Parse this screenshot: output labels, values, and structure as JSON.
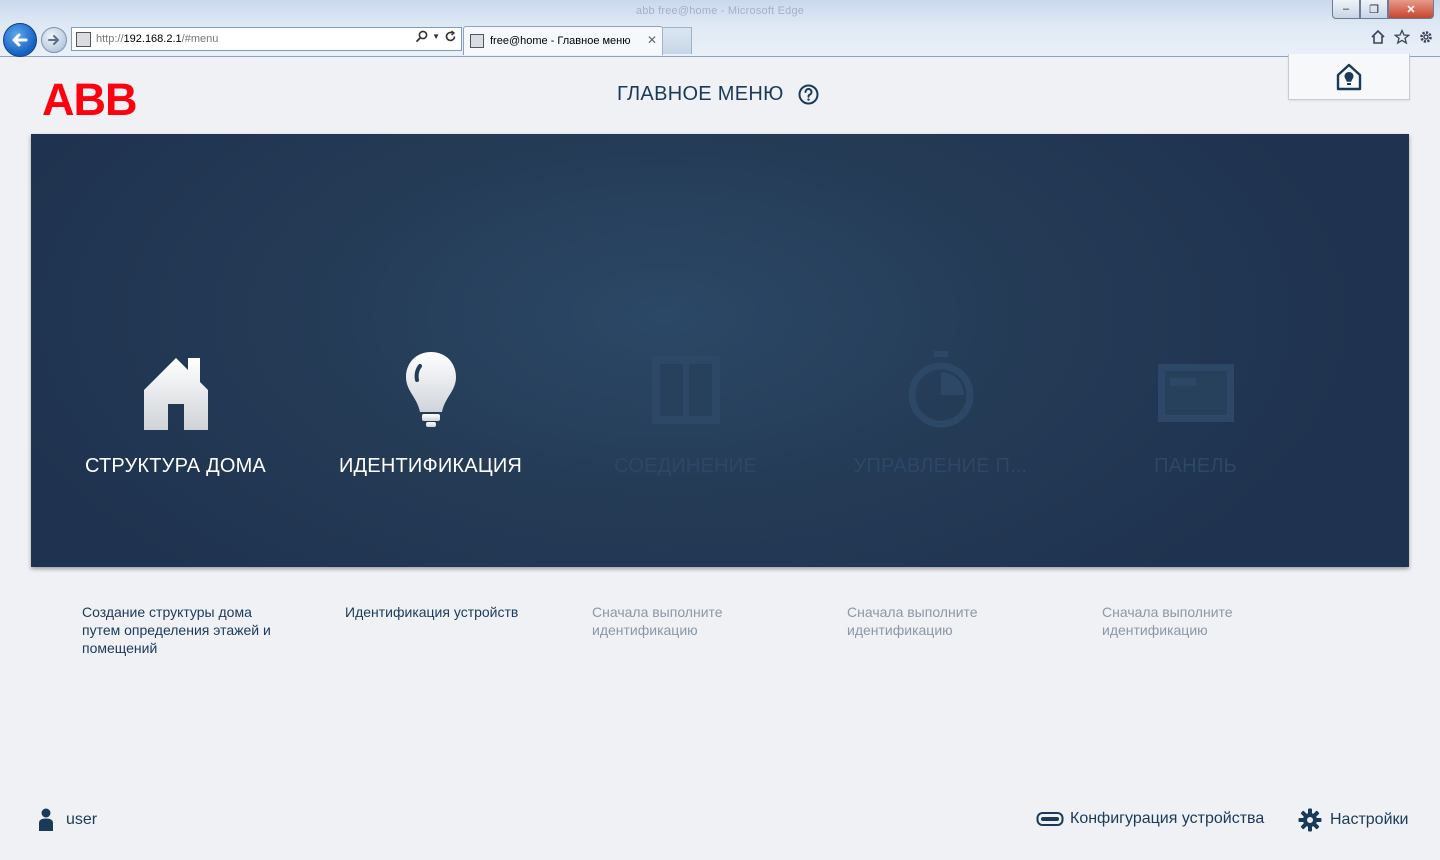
{
  "browser": {
    "window_title": "abb free@home - Microsoft Edge",
    "address": {
      "prefix": "http://",
      "host": "192.168.2.1",
      "path": "/#menu"
    },
    "tab_title": "free@home - Главное меню"
  },
  "header": {
    "logo_text": "ABB",
    "title": "ГЛАВНОЕ МЕНЮ"
  },
  "tiles": [
    {
      "label": "СТРУКТУРА ДОМА",
      "icon": "house-icon",
      "enabled": true,
      "description": "Создание структуры дома путем определения этажей и помещений"
    },
    {
      "label": "ИДЕНТИФИКАЦИЯ",
      "icon": "lightbulb-icon",
      "enabled": true,
      "description": "Идентификация устройств"
    },
    {
      "label": "СОЕДИНЕНИЕ",
      "icon": "window-icon",
      "enabled": false,
      "description": "Сначала выполните идентификацию"
    },
    {
      "label": "УПРАВЛЕНИЕ П...",
      "icon": "timer-icon",
      "enabled": false,
      "description": "Сначала выполните идентификацию"
    },
    {
      "label": "ПАНЕЛЬ",
      "icon": "panel-icon",
      "enabled": false,
      "description": "Сначала выполните идентификацию"
    }
  ],
  "footer": {
    "user_label": "user",
    "config_label": "Конфигурация устройства",
    "settings_label": "Настройки"
  },
  "colors": {
    "brand_red": "#ff000f",
    "panel_bg": "#243a55",
    "text_primary": "#1b3a5a",
    "text_disabled": "#8c98a6"
  }
}
